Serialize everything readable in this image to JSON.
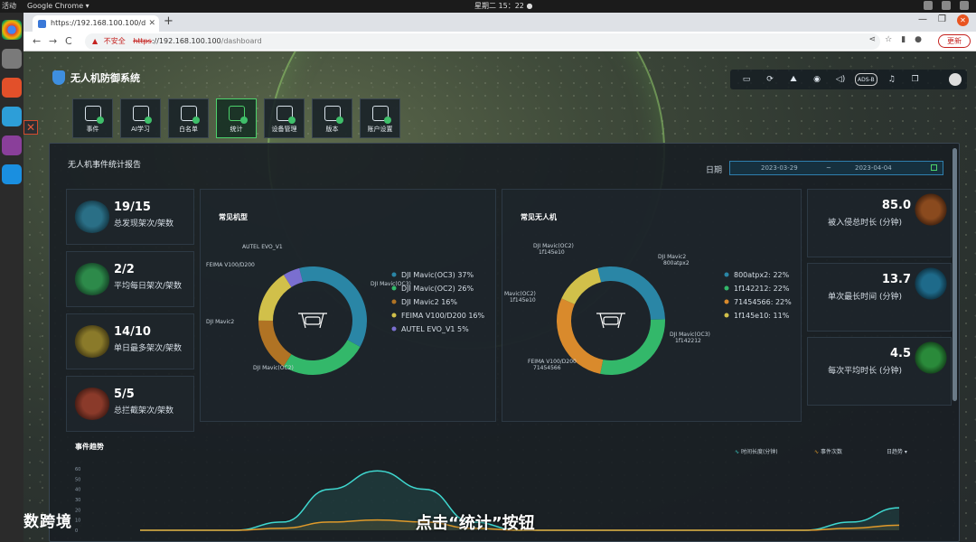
{
  "os": {
    "activities": "活动",
    "app_name": "Google Chrome ▾",
    "clock": "星期二 15：22 ●"
  },
  "browser": {
    "tab_title": "https://192.168.100.100/d",
    "new_tab": "+",
    "back": "←",
    "forward": "→",
    "reload": "C",
    "insecure": "不安全",
    "url_scheme": "https",
    "url_host": "://192.168.100.100",
    "url_path": "/dashboard",
    "update": "更新",
    "win_min": "—",
    "win_max": "❐",
    "win_close": "✕"
  },
  "app": {
    "system_name": "无人机防御系统",
    "close_x": "✕",
    "adsb": "ADS-B",
    "nav": [
      {
        "label": "事件"
      },
      {
        "label": "AI学习"
      },
      {
        "label": "白名单"
      },
      {
        "label": "统计",
        "active": true
      },
      {
        "label": "设备管理"
      },
      {
        "label": "版本"
      },
      {
        "label": "账户设置"
      }
    ]
  },
  "report": {
    "title": "无人机事件统计报告",
    "date_label": "日期",
    "date_start": "2023-03-29",
    "date_sep": "~",
    "date_end": "2023-04-04",
    "stats": [
      {
        "value": "19/15",
        "label": "总发现架次/架数"
      },
      {
        "value": "2/2",
        "label": "平均每日架次/架数"
      },
      {
        "value": "14/10",
        "label": "单日最多架次/架数"
      },
      {
        "value": "5/5",
        "label": "总拦截架次/架数"
      }
    ],
    "right_stats": [
      {
        "value": "85.0",
        "label": "被入侵总时长 (分钟)"
      },
      {
        "value": "13.7",
        "label": "单次最长时间 (分钟)"
      },
      {
        "value": "4.5",
        "label": "每次平均时长 (分钟)"
      }
    ]
  },
  "chart_data": [
    {
      "type": "pie",
      "title": "常见机型",
      "categories": [
        "DJI Mavic(OC3)",
        "DJI Mavic(OC2)",
        "DJI Mavic2",
        "FEIMA V100/D200",
        "AUTEL EVO_V1"
      ],
      "values": [
        37,
        26,
        16,
        16,
        5
      ],
      "legend": [
        "DJI Mavic(OC3) 37%",
        "DJI Mavic(OC2) 26%",
        "DJI Mavic2 16%",
        "FEIMA V100/D200 16%",
        "AUTEL EVO_V1 5%"
      ],
      "slice_labels": [
        "DJI Mavic(OC3)",
        "DJI Mavic(OC2)",
        "DJI Mavic2",
        "FEIMA V100/D200",
        "AUTEL EVO_V1"
      ],
      "colors": [
        "#2a86a6",
        "#33b86a",
        "#b07324",
        "#d1c04a",
        "#7a6fd0"
      ]
    },
    {
      "type": "pie",
      "title": "常见无人机",
      "categories": [
        "800atpx2",
        "1f142212",
        "71454566",
        "1f145e10"
      ],
      "values": [
        22,
        22,
        22,
        11
      ],
      "legend": [
        "800atpx2: 22%",
        "1f142212: 22%",
        "71454566: 22%",
        "1f145e10: 11%"
      ],
      "slice_labels": [
        "DJI Mavic2 800atpx2",
        "DJI Mavic(OC3) 1f142212",
        "FEIMA V100/D200 71454566",
        "Mavic(OC2) 1f145e10",
        "DJI Mavic(OC2) 1f145e10"
      ],
      "colors": [
        "#2a86a6",
        "#33b86a",
        "#d98a2c",
        "#d1c04a"
      ]
    },
    {
      "type": "area",
      "title": "事件趋势",
      "y_ticks": [
        "60",
        "50",
        "40",
        "30",
        "20",
        "10",
        "0"
      ],
      "ylim": [
        0,
        60
      ],
      "series": [
        {
          "name": "时间长度(分钟)",
          "color": "#3fd8d0",
          "values": [
            0,
            0,
            0,
            8,
            40,
            58,
            40,
            8,
            0,
            0,
            0,
            0,
            0,
            0,
            0,
            8,
            22
          ]
        },
        {
          "name": "事件次数",
          "color": "#e09a2a",
          "values": [
            0,
            0,
            0,
            2,
            8,
            10,
            8,
            2,
            0,
            0,
            0,
            0,
            0,
            0,
            0,
            2,
            5
          ]
        }
      ],
      "range_select": "日趋势 ▾"
    }
  ],
  "watermark": "大数跨境",
  "caption": "点击“统计”按钮"
}
